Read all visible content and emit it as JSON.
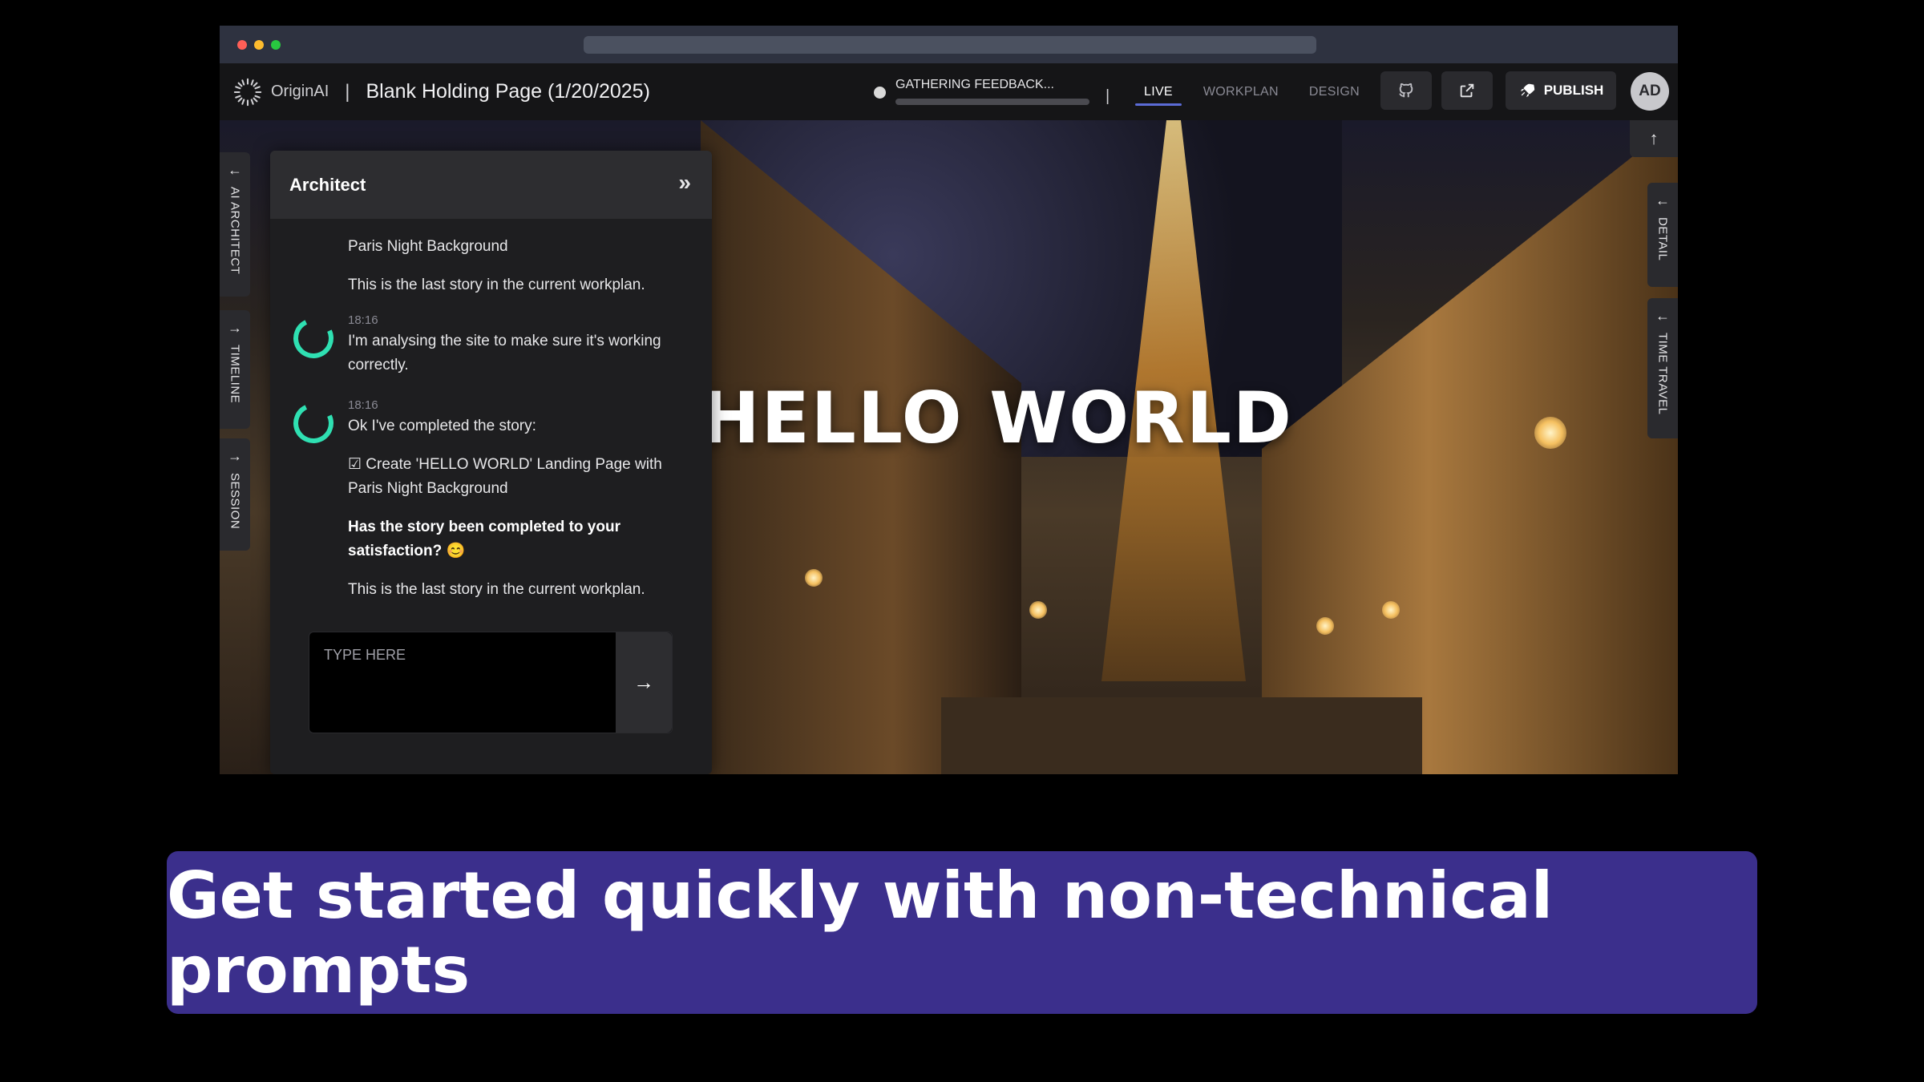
{
  "window": {
    "dots": [
      "#ff5f57",
      "#febc2e",
      "#28c840"
    ]
  },
  "appbar": {
    "logo_text": "OriginAI",
    "separator": "|",
    "page_title": "Blank Holding Page (1/20/2025)",
    "status_text": "GATHERING FEEDBACK...",
    "status_progress_fraction": 0.0,
    "tab_separator": "|",
    "tabs": [
      {
        "label": "LIVE",
        "active": true
      },
      {
        "label": "WORKPLAN",
        "active": false
      },
      {
        "label": "DESIGN",
        "active": false
      }
    ],
    "github_icon": "github-icon",
    "external_icon": "external-link-icon",
    "publish_label": "PUBLISH",
    "avatar_initials": "AD"
  },
  "left_tabs": [
    {
      "label": "AI ARCHITECT",
      "arrow": "←"
    },
    {
      "label": "TIMELINE",
      "arrow": "→"
    },
    {
      "label": "SESSION",
      "arrow": "→"
    }
  ],
  "right_tabs": [
    {
      "label": "DETAIL",
      "arrow": "←"
    },
    {
      "label": "TIME TRAVEL",
      "arrow": "←"
    }
  ],
  "preview": {
    "hero_title": "HELLO WORLD"
  },
  "architect": {
    "title": "Architect",
    "messages": [
      {
        "lines": [
          "Paris Night Background"
        ]
      },
      {
        "lines": [
          "This is the last story in the current workplan."
        ]
      },
      {
        "time": "18:16",
        "text": "I'm analysing the site to make sure it's working correctly."
      },
      {
        "time": "18:16",
        "text": "Ok I've completed the story:"
      },
      {
        "text": "☑ Create 'HELLO WORLD' Landing Page with Paris Night Background"
      },
      {
        "bold": "Has the story been completed to your satisfaction? 😊"
      },
      {
        "text": "This is the last story in the current workplan."
      }
    ],
    "input_placeholder": "TYPE HERE"
  },
  "banner": {
    "text": "Get started quickly with non-technical prompts"
  }
}
